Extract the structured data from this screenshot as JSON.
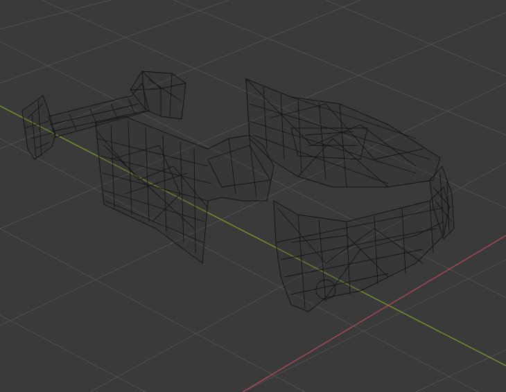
{
  "viewport": {
    "name": "3D Viewport",
    "shading_mode": "wireframe",
    "object_type": "mesh",
    "colors": {
      "background": "#3a3a3a",
      "grid": "#505050",
      "x_axis": "#b34a57",
      "y_axis": "#7a9a2e",
      "wireframe": "#141414"
    }
  }
}
